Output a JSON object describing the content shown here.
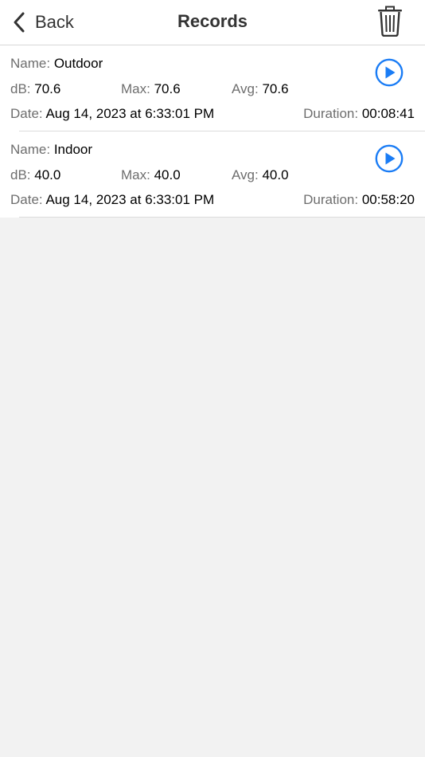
{
  "nav": {
    "back_label": "Back",
    "title": "Records",
    "back_icon": "chevron-left-icon",
    "delete_icon": "trash-icon"
  },
  "labels": {
    "name": "Name:",
    "db": "dB:",
    "max": "Max:",
    "avg": "Avg:",
    "date": "Date:",
    "duration": "Duration:"
  },
  "records": [
    {
      "name": "Outdoor",
      "db": "70.6",
      "max": "70.6",
      "avg": "70.6",
      "date": "Aug 14, 2023 at 6:33:01 PM",
      "duration": "00:08:41"
    },
    {
      "name": "Indoor",
      "db": "40.0",
      "max": "40.0",
      "avg": "40.0",
      "date": "Aug 14, 2023 at 6:33:01 PM",
      "duration": "00:58:20"
    }
  ],
  "colors": {
    "accent": "#1a7cf5",
    "background": "#f2f2f2",
    "surface": "#ffffff",
    "label_gray": "#6e6e6e"
  }
}
